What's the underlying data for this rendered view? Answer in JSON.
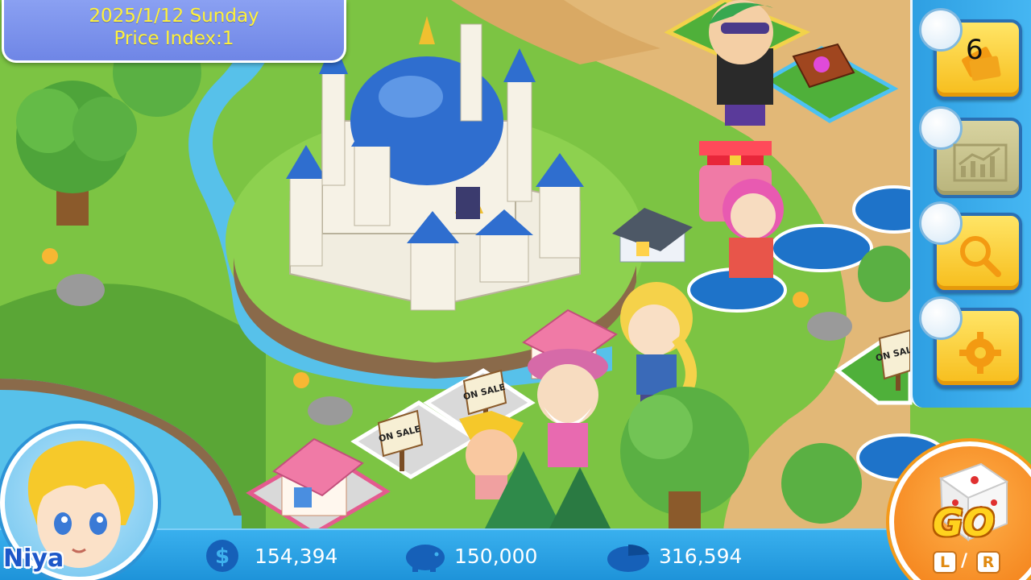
{
  "hud": {
    "date": "2025/1/12  Sunday",
    "price_index": "Price Index:1"
  },
  "side_menu": {
    "cards_count": "6",
    "buttons": [
      "cards-button",
      "stock-chart-button",
      "search-button",
      "settings-button"
    ]
  },
  "player": {
    "name": "Niya",
    "cash": "154,394",
    "savings": "150,000",
    "total_assets": "316,594"
  },
  "board": {
    "sale_signs": [
      "ON SALE",
      "ON SALE",
      "ON SALE"
    ]
  },
  "go_button": {
    "label": "GO",
    "key_left": "L",
    "separator": "/",
    "key_right": "R"
  },
  "colors": {
    "grass": "#7cc443",
    "road": "#e2b877",
    "river": "#57c1ea",
    "hud_panel": "#7b92ec",
    "hud_text": "#fff23a",
    "menu_bar": "#2e9fe2",
    "bottom_bar": "#2aa2e6",
    "go_orange": "#f27a12"
  }
}
